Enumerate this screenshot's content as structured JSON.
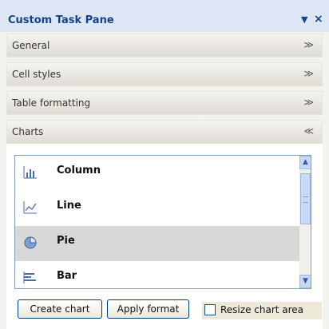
{
  "pane": {
    "title": "Custom Task Pane",
    "dropdown_glyph": "▼",
    "close_glyph": "×"
  },
  "sections": [
    {
      "label": "General",
      "state": "collapsed",
      "chevron": "≫"
    },
    {
      "label": "Cell styles",
      "state": "collapsed",
      "chevron": "≫"
    },
    {
      "label": "Table formatting",
      "state": "collapsed",
      "chevron": "≫"
    },
    {
      "label": "Charts",
      "state": "expanded",
      "chevron": "≪"
    }
  ],
  "charts": {
    "items": [
      {
        "label": "Column",
        "icon": "column-chart-icon",
        "selected": false
      },
      {
        "label": "Line",
        "icon": "line-chart-icon",
        "selected": false
      },
      {
        "label": "Pie",
        "icon": "pie-chart-icon",
        "selected": true
      },
      {
        "label": "Bar",
        "icon": "bar-chart-icon",
        "selected": false
      }
    ],
    "buttons": {
      "create": "Create chart",
      "apply": "Apply format"
    },
    "resize_checkbox": {
      "label": "Resize chart area",
      "checked": false
    }
  },
  "colors": {
    "title_text": "#15428b",
    "title_bg": "#dce6f4",
    "selection": "#d8d8d8"
  }
}
